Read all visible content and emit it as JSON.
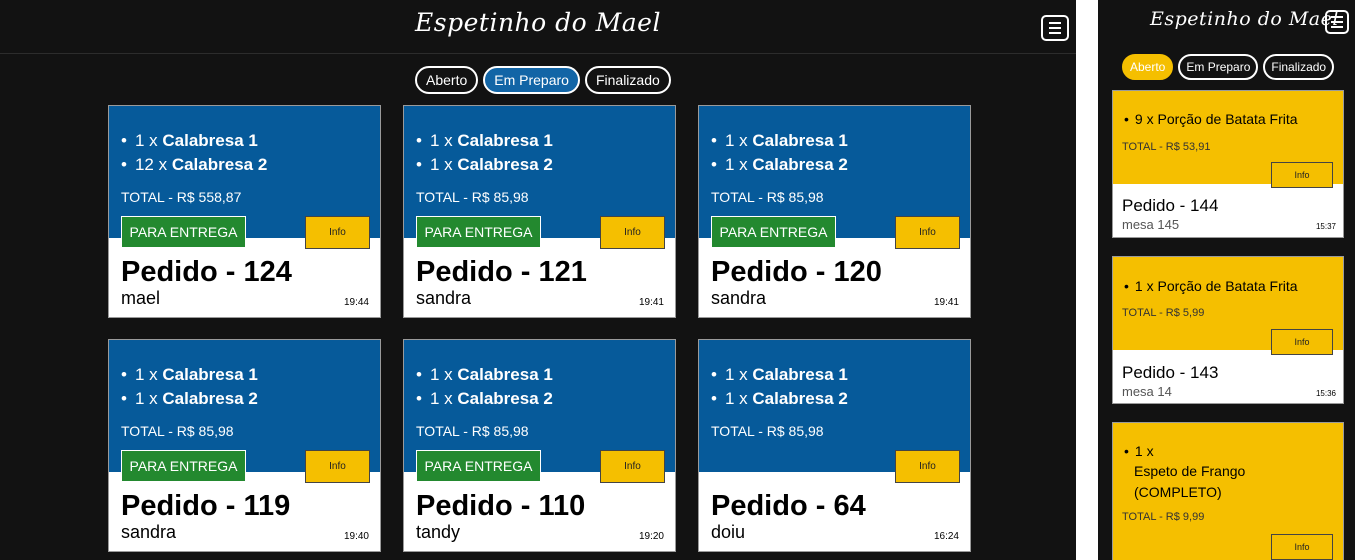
{
  "app": {
    "title": "Espetinho do Mael"
  },
  "desktop": {
    "filters": [
      {
        "label": "Aberto",
        "state": "normal"
      },
      {
        "label": "Em Preparo",
        "state": "active"
      },
      {
        "label": "Finalizado",
        "state": "normal"
      }
    ],
    "orders": [
      {
        "pedido": "Pedido - 124",
        "cliente": "mael",
        "hora": "19:44",
        "total": "TOTAL - R$ 558,87",
        "entrega": "PARA ENTREGA",
        "items": [
          {
            "qty": "1 x",
            "name": "Calabresa 1"
          },
          {
            "qty": "12 x",
            "name": "Calabresa 2"
          }
        ]
      },
      {
        "pedido": "Pedido - 121",
        "cliente": "sandra",
        "hora": "19:41",
        "total": "TOTAL - R$ 85,98",
        "entrega": "PARA ENTREGA",
        "items": [
          {
            "qty": "1 x",
            "name": "Calabresa 1"
          },
          {
            "qty": "1 x",
            "name": "Calabresa 2"
          }
        ]
      },
      {
        "pedido": "Pedido - 120",
        "cliente": "sandra",
        "hora": "19:41",
        "total": "TOTAL - R$ 85,98",
        "entrega": "PARA ENTREGA",
        "items": [
          {
            "qty": "1 x",
            "name": "Calabresa 1"
          },
          {
            "qty": "1 x",
            "name": "Calabresa 2"
          }
        ]
      },
      {
        "pedido": "Pedido - 119",
        "cliente": "sandra",
        "hora": "19:40",
        "total": "TOTAL - R$ 85,98",
        "entrega": "PARA ENTREGA",
        "items": [
          {
            "qty": "1 x",
            "name": "Calabresa 1"
          },
          {
            "qty": "1 x",
            "name": "Calabresa 2"
          }
        ]
      },
      {
        "pedido": "Pedido - 110",
        "cliente": "tandy",
        "hora": "19:20",
        "total": "TOTAL - R$ 85,98",
        "entrega": "PARA ENTREGA",
        "items": [
          {
            "qty": "1 x",
            "name": "Calabresa 1"
          },
          {
            "qty": "1 x",
            "name": "Calabresa 2"
          }
        ]
      },
      {
        "pedido": "Pedido - 64",
        "cliente": "doiu",
        "hora": "16:24",
        "total": "TOTAL - R$ 85,98",
        "entrega": "",
        "items": [
          {
            "qty": "1 x",
            "name": "Calabresa 1"
          },
          {
            "qty": "1 x",
            "name": "Calabresa 2"
          }
        ]
      }
    ],
    "info_label": "Info"
  },
  "mobile": {
    "filters": [
      {
        "label": "Aberto",
        "state": "active"
      },
      {
        "label": "Em Preparo",
        "state": "normal"
      },
      {
        "label": "Finalizado",
        "state": "normal"
      }
    ],
    "orders": [
      {
        "pedido": "Pedido - 144",
        "cliente": "mesa 145",
        "hora": "15:37",
        "total": "TOTAL - R$ 53,91",
        "items": [
          {
            "qty": "9 x",
            "name": "Porção de Batata Frita"
          }
        ]
      },
      {
        "pedido": "Pedido - 143",
        "cliente": "mesa 14",
        "hora": "15:36",
        "total": "TOTAL - R$ 5,99",
        "items": [
          {
            "qty": "1 x",
            "name": "Porção de Batata Frita"
          }
        ]
      },
      {
        "pedido": "",
        "cliente": "",
        "hora": "",
        "total": "TOTAL - R$ 9,99",
        "items": [
          {
            "qty": "1 x",
            "name": "Espeto de Frango (COMPLETO)"
          }
        ]
      }
    ],
    "info_label": "Info"
  },
  "colors": {
    "background": "#121212",
    "card_blue": "#065a9a",
    "card_yellow": "#f5bf00",
    "pill_active_blue": "#1265a6",
    "entrega_green": "#23892f"
  },
  "icons": {
    "menu": "hamburger-menu-icon"
  }
}
